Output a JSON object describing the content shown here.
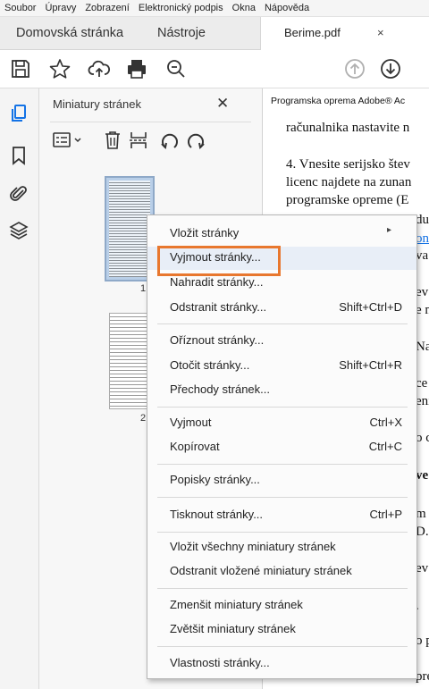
{
  "menubar": [
    "Soubor",
    "Úpravy",
    "Zobrazení",
    "Elektronický podpis",
    "Okna",
    "Nápověda"
  ],
  "tabs": {
    "home": "Domovská stránka",
    "tools": "Nástroje",
    "document": "Berime.pdf",
    "close_glyph": "×"
  },
  "toolbar": {
    "icons": [
      "save-icon",
      "star-icon",
      "upload-cloud-icon",
      "print-icon",
      "zoom-out-icon",
      "page-up-icon",
      "page-down-icon"
    ]
  },
  "rail": {
    "icons": [
      "page-thumbnails-icon",
      "bookmark-icon",
      "attachment-icon",
      "layers-icon"
    ]
  },
  "panel": {
    "title": "Miniatury stránek",
    "close": "✕",
    "thumbs": [
      {
        "page": "1"
      },
      {
        "page": "2"
      }
    ]
  },
  "document": {
    "header": "Programska oprema Adobe® Ac",
    "lines": [
      "računalnika nastavite n",
      "4. Vnesite serijsko štev",
      "licenc najdete na zunan",
      "programske opreme (E",
      "du",
      "on",
      "va",
      "ev",
      "e n",
      "Na",
      "ce",
      "eni",
      "o c",
      "ve",
      "m",
      "D.",
      "ev",
      ".",
      "o p",
      "pre"
    ]
  },
  "context_menu": {
    "items": [
      {
        "label": "Vložit stránky",
        "shortcut": "",
        "submenu": true
      },
      {
        "label": "Vyjmout stránky...",
        "shortcut": "",
        "highlighted": true
      },
      {
        "label": "Nahradit stránky...",
        "shortcut": ""
      },
      {
        "label": "Odstranit stránky...",
        "shortcut": "Shift+Ctrl+D"
      },
      {
        "label": "Oříznout stránky...",
        "shortcut": ""
      },
      {
        "label": "Otočit stránky...",
        "shortcut": "Shift+Ctrl+R"
      },
      {
        "label": "Přechody stránek...",
        "shortcut": ""
      },
      {
        "label": "Vyjmout",
        "shortcut": "Ctrl+X"
      },
      {
        "label": "Kopírovat",
        "shortcut": "Ctrl+C"
      },
      {
        "label": "Popisky stránky...",
        "shortcut": ""
      },
      {
        "label": "Tisknout stránky...",
        "shortcut": "Ctrl+P"
      },
      {
        "label": "Vložit všechny miniatury stránek",
        "shortcut": ""
      },
      {
        "label": "Odstranit vložené miniatury stránek",
        "shortcut": ""
      },
      {
        "label": "Zmenšit miniatury stránek",
        "shortcut": ""
      },
      {
        "label": "Zvětšit miniatury stránek",
        "shortcut": ""
      },
      {
        "label": "Vlastnosti stránky...",
        "shortcut": ""
      }
    ]
  },
  "colors": {
    "accent": "#1473e6",
    "highlight_outline": "#e8772e"
  }
}
